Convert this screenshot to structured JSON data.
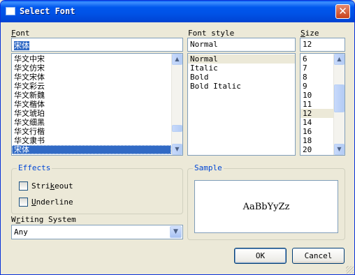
{
  "window": {
    "title": "Select Font",
    "close_label": "✕"
  },
  "font": {
    "label_underlined": "F",
    "label_rest": "ont",
    "value": "宋体",
    "items": [
      "华文中宋",
      "华文仿宋",
      "华文宋体",
      "华文彩云",
      "华文新魏",
      "华文楷体",
      "华文琥珀",
      "华文细黑",
      "华文行楷",
      "华文隶书",
      "宋体"
    ],
    "selected": "宋体"
  },
  "style": {
    "label": "Font style",
    "value": "Normal",
    "items": [
      "Normal",
      "Italic",
      "Bold",
      "Bold Italic"
    ],
    "selected": "Normal"
  },
  "size": {
    "label_underlined": "S",
    "label_rest": "ize",
    "value": "12",
    "items": [
      "6",
      "7",
      "8",
      "9",
      "10",
      "11",
      "12",
      "14",
      "16",
      "18",
      "20"
    ],
    "selected": "12"
  },
  "effects": {
    "title": "Effects",
    "strikeout_pre": "Stri",
    "strikeout_u": "k",
    "strikeout_post": "eout",
    "strikeout_checked": false,
    "underline_u": "U",
    "underline_post": "nderline",
    "underline_checked": false
  },
  "sample": {
    "title": "Sample",
    "text": "AaBbYyZz"
  },
  "writing_system": {
    "label_pre": "W",
    "label_u": "r",
    "label_post": "iting System",
    "value": "Any"
  },
  "buttons": {
    "ok": "OK",
    "cancel": "Cancel"
  }
}
